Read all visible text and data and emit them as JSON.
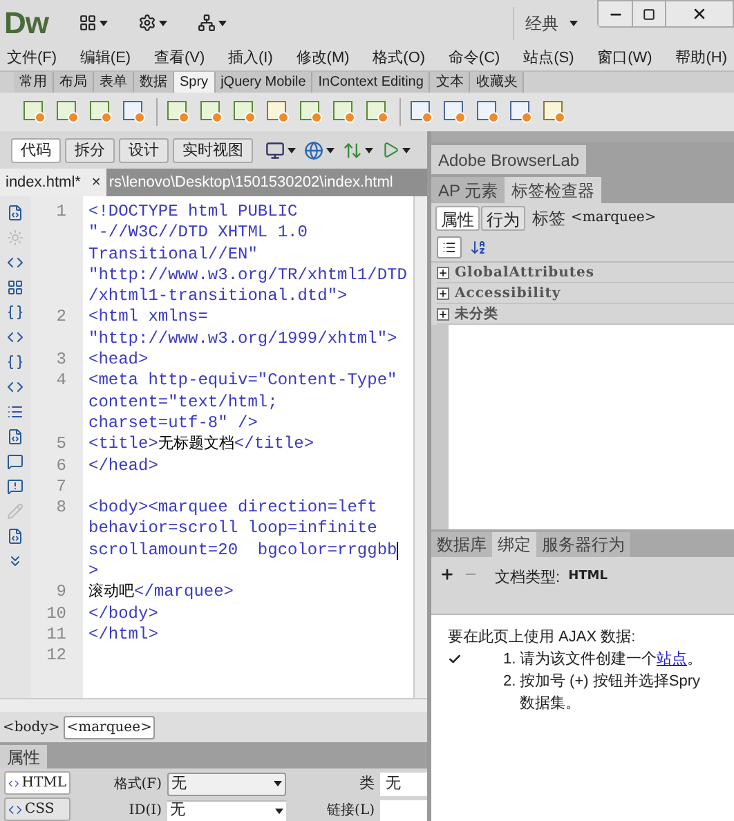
{
  "app": {
    "logo": "Dw",
    "workspace": "经典"
  },
  "menu": [
    "文件(F)",
    "编辑(E)",
    "查看(V)",
    "插入(I)",
    "修改(M)",
    "格式(O)",
    "命令(C)",
    "站点(S)",
    "窗口(W)",
    "帮助(H)"
  ],
  "insert_tabs": [
    {
      "label": "常用",
      "selected": false
    },
    {
      "label": "布局",
      "selected": false
    },
    {
      "label": "表单",
      "selected": false
    },
    {
      "label": "数据",
      "selected": false
    },
    {
      "label": "Spry",
      "selected": true
    },
    {
      "label": "jQuery Mobile",
      "selected": false
    },
    {
      "label": "InContext Editing",
      "selected": false
    },
    {
      "label": "文本",
      "selected": false
    },
    {
      "label": "收藏夹",
      "selected": false
    }
  ],
  "view_buttons": [
    {
      "label": "代码",
      "selected": true
    },
    {
      "label": "拆分",
      "selected": false
    },
    {
      "label": "设计",
      "selected": false
    },
    {
      "label": "实时视图",
      "selected": false
    }
  ],
  "document_tab": {
    "label": "index.html*",
    "close": "×",
    "path": "rs\\lenovo\\Desktop\\1501530202\\index.html"
  },
  "code_lines": [
    {
      "number": "1",
      "rows": [
        [
          {
            "kind": "code",
            "text": "<!DOCTYPE html PUBLIC"
          }
        ],
        [
          {
            "kind": "code",
            "text": "\"-//W3C//DTD XHTML 1.0"
          }
        ],
        [
          {
            "kind": "code",
            "text": "Transitional//EN\""
          }
        ],
        [
          {
            "kind": "code",
            "text": "\"http://www.w3.org/TR/xhtml1/DTD"
          }
        ],
        [
          {
            "kind": "code",
            "text": "/xhtml1-transitional.dtd\">"
          }
        ]
      ]
    },
    {
      "number": "2",
      "rows": [
        [
          {
            "kind": "code",
            "text": "<html xmlns="
          }
        ],
        [
          {
            "kind": "code",
            "text": "\"http://www.w3.org/1999/xhtml\">"
          }
        ]
      ]
    },
    {
      "number": "3",
      "rows": [
        [
          {
            "kind": "code",
            "text": "<head>"
          }
        ]
      ]
    },
    {
      "number": "4",
      "rows": [
        [
          {
            "kind": "code",
            "text": "<meta http-equiv=\"Content-Type\""
          }
        ],
        [
          {
            "kind": "code",
            "text": "content=\"text/html;"
          }
        ],
        [
          {
            "kind": "code",
            "text": "charset=utf-8\" />"
          }
        ]
      ]
    },
    {
      "number": "5",
      "rows": [
        [
          {
            "kind": "code",
            "text": "<title>"
          },
          {
            "kind": "text",
            "text": "无标题文档"
          },
          {
            "kind": "code",
            "text": "</title>"
          }
        ]
      ]
    },
    {
      "number": "6",
      "rows": [
        [
          {
            "kind": "code",
            "text": "</head>"
          }
        ]
      ]
    },
    {
      "number": "7",
      "rows": [
        []
      ]
    },
    {
      "number": "8",
      "rows": [
        [
          {
            "kind": "code",
            "text": "<body><marquee direction=left"
          }
        ],
        [
          {
            "kind": "code",
            "text": "behavior=scroll loop=infinite"
          }
        ],
        [
          {
            "kind": "code",
            "text": "scrollamount=20  bgcolor=rrggbb"
          },
          {
            "kind": "cursor",
            "text": ""
          }
        ],
        [
          {
            "kind": "code",
            "text": ">"
          }
        ]
      ]
    },
    {
      "number": "9",
      "rows": [
        [
          {
            "kind": "text",
            "text": "滚动吧"
          },
          {
            "kind": "code",
            "text": "</marquee>"
          }
        ]
      ]
    },
    {
      "number": "10",
      "rows": [
        [
          {
            "kind": "code",
            "text": "</body>"
          }
        ]
      ]
    },
    {
      "number": "11",
      "rows": [
        [
          {
            "kind": "code",
            "text": "</html>"
          }
        ]
      ]
    },
    {
      "number": "12",
      "rows": [
        []
      ]
    }
  ],
  "tag_selector": [
    {
      "label": "<body>",
      "selected": false
    },
    {
      "label": "<marquee>",
      "selected": true
    }
  ],
  "properties": {
    "title": "属性",
    "modes": [
      {
        "label": "HTML",
        "selected": true
      },
      {
        "label": "CSS",
        "selected": false
      }
    ],
    "format_label": "格式(F)",
    "format_value": "无",
    "class_label": "类",
    "class_value": "无",
    "id_label": "ID(I)",
    "id_value": "无",
    "link_label": "链接(L)"
  },
  "right_panel": {
    "browserlab_tab": "Adobe BrowserLab",
    "inspector_tabs": [
      {
        "label": "AP 元素",
        "selected": false
      },
      {
        "label": "标签检查器",
        "selected": true
      }
    ],
    "inspector_modes": [
      {
        "label": "属性",
        "selected": true
      },
      {
        "label": "行为",
        "selected": false
      }
    ],
    "tag_label": "标签",
    "tag_value": "<marquee>",
    "categories": [
      {
        "label": "GlobalAttributes",
        "expanded": false
      },
      {
        "label": "Accessibility",
        "expanded": false
      },
      {
        "label": "未分类",
        "expanded": false
      }
    ],
    "bindings_tabs": [
      {
        "label": "数据库",
        "selected": false
      },
      {
        "label": "绑定",
        "selected": true
      },
      {
        "label": "服务器行为",
        "selected": false
      }
    ],
    "doc_type_label": "文档类型:",
    "doc_type_value": "HTML",
    "ajax_intro": "要在此页上使用 AJAX 数据:",
    "steps": [
      {
        "number": "1.",
        "done": true,
        "before": "请为该文件创建一个",
        "link": "站点",
        "after": "。"
      },
      {
        "number": "2.",
        "done": false,
        "before": "按加号 (+) 按钮并选择Spry 数据集。"
      }
    ]
  }
}
